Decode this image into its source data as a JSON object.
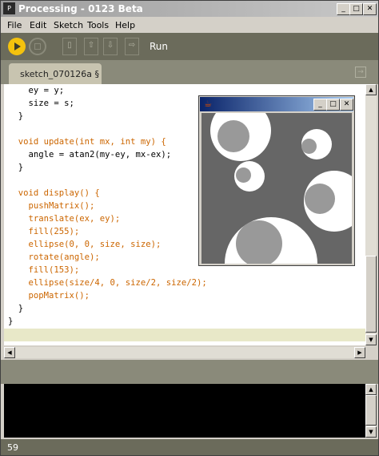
{
  "window": {
    "title": "Processing - 0123 Beta",
    "icon": "P"
  },
  "menu": [
    "File",
    "Edit",
    "Sketch",
    "Tools",
    "Help"
  ],
  "toolbar": {
    "run_label": "Run",
    "buttons": [
      "run-icon",
      "stop-icon",
      "new-icon",
      "open-icon",
      "save-icon",
      "export-icon"
    ]
  },
  "tab": {
    "label": "sketch_070126a §"
  },
  "code": {
    "lines": [
      "    ey = y;",
      "    size = s;",
      "  }",
      "",
      "  void update(int mx, int my) {",
      "    angle = atan2(my-ey, mx-ex);",
      "  }",
      "",
      "  void display() {",
      "    pushMatrix();",
      "    translate(ex, ey);",
      "    fill(255);",
      "    ellipse(0, 0, size, size);",
      "    rotate(angle);",
      "    fill(153);",
      "    ellipse(size/4, 0, size/2, size/2);",
      "    popMatrix();",
      "  }",
      "}"
    ]
  },
  "status": {
    "line_number": "59"
  },
  "sketch_window": {
    "icon": "java-icon"
  },
  "colors": {
    "toolbar_bg": "#6b6b5b",
    "run_yellow": "#f4c20d",
    "keyword": "#cc6600",
    "canvas_bg": "#666666",
    "eye_white": "#ffffff",
    "pupil_gray": "#999999"
  }
}
